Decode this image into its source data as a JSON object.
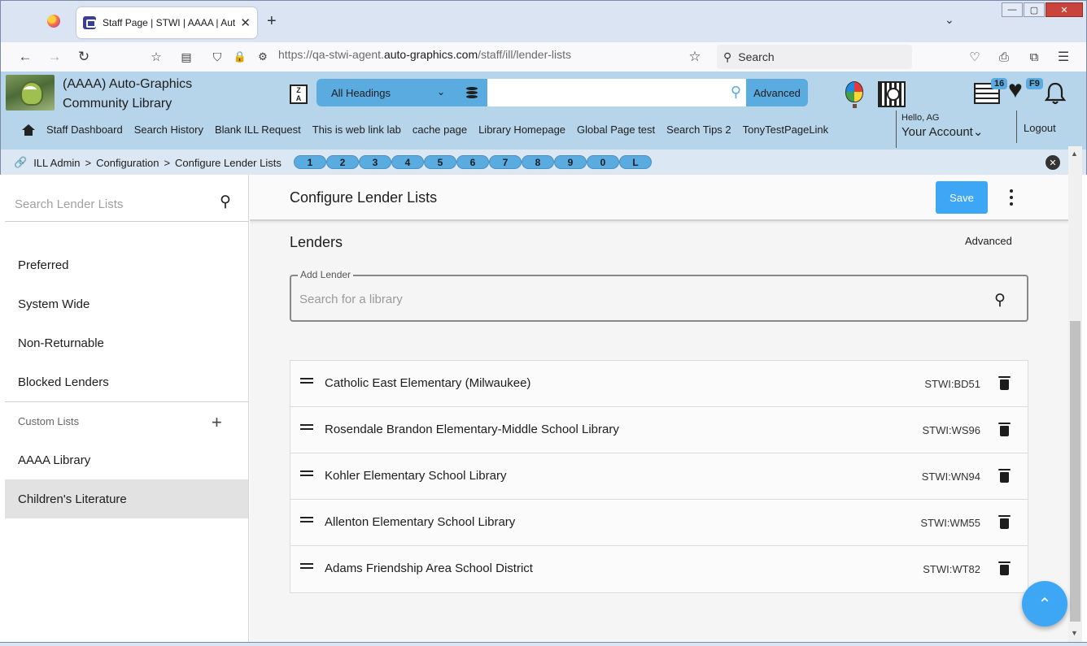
{
  "browser": {
    "tab_title": "Staff Page | STWI | AAAA | Auto",
    "url_prefix": "https://qa-stwi-agent.",
    "url_domain": "auto-graphics.com",
    "url_path": "/staff/ill/lender-lists",
    "search_placeholder": "Search"
  },
  "header": {
    "library_name_line1": "(AAAA) Auto-Graphics",
    "library_name_line2": "Community Library",
    "heading_select": "All Headings",
    "search_value": "",
    "advanced_label": "Advanced",
    "badge_list": "16",
    "badge_fav": "F9",
    "nav_links": [
      "Staff Dashboard",
      "Search History",
      "Blank ILL Request",
      "This is web link lab",
      "cache page",
      "Library Homepage",
      "Global Page test",
      "Search Tips 2",
      "TonyTestPageLink"
    ],
    "hello": "Hello, AG",
    "your_account": "Your Account",
    "logout": "Logout"
  },
  "breadcrumb": {
    "items": [
      "ILL Admin",
      "Configuration",
      "Configure Lender Lists"
    ],
    "pager": [
      "1",
      "2",
      "3",
      "4",
      "5",
      "6",
      "7",
      "8",
      "9",
      "0",
      "L"
    ]
  },
  "sidebar": {
    "search_placeholder": "Search Lender Lists",
    "items": [
      "Preferred",
      "System Wide",
      "Non-Returnable",
      "Blocked Lenders"
    ],
    "custom_label": "Custom Lists",
    "custom_items": [
      "AAAA Library",
      "Children's Literature"
    ]
  },
  "main": {
    "title": "Configure Lender Lists",
    "save_label": "Save",
    "lenders_title": "Lenders",
    "advanced_label": "Advanced",
    "add_lender_label": "Add Lender",
    "add_lender_placeholder": "Search for a library",
    "lenders": [
      {
        "name": "Catholic East Elementary (Milwaukee)",
        "code": "STWI:BD51"
      },
      {
        "name": "Rosendale Brandon Elementary-Middle School Library",
        "code": "STWI:WS96"
      },
      {
        "name": "Kohler Elementary School Library",
        "code": "STWI:WN94"
      },
      {
        "name": "Allenton Elementary School Library",
        "code": "STWI:WM55"
      },
      {
        "name": "Adams Friendship Area School District",
        "code": "STWI:WT82"
      }
    ]
  },
  "colors": {
    "header_bg": "#b7d5ea",
    "accent": "#5aabe0",
    "save_button": "#3da7f5"
  }
}
